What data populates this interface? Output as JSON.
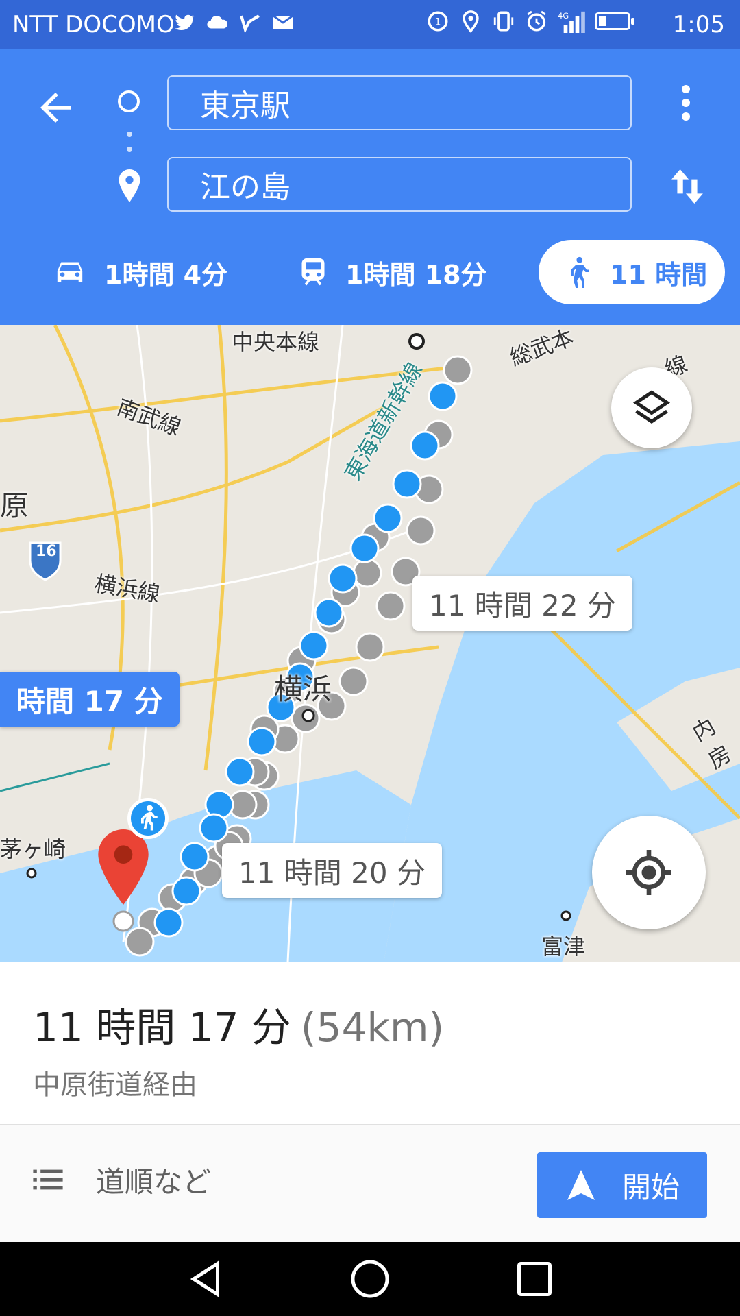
{
  "status_bar": {
    "carrier": "NTT DOCOMO",
    "time": "1:05",
    "network": "4G"
  },
  "header": {
    "origin": "東京駅",
    "destination": "江の島",
    "modes": [
      {
        "icon": "car-icon",
        "label": "1時間 4分"
      },
      {
        "icon": "train-icon",
        "label": "1時間 18分"
      },
      {
        "icon": "walk-icon",
        "label": "11 時間",
        "selected": true
      }
    ]
  },
  "map": {
    "labels": [
      "中央本線",
      "総武本",
      "線",
      "南武線",
      "東海道新幹線",
      "原",
      "横浜線",
      "横浜",
      "茅ヶ崎",
      "内房",
      "富津"
    ],
    "route_badge": "16",
    "bubbles": {
      "selected": "時間 17 分",
      "alt1": "11 時間 22 分",
      "alt2": "11 時間 20 分"
    },
    "route_color": "#2196f3",
    "alt_route_color": "#9e9e9e"
  },
  "summary": {
    "duration": "11 時間 17 分",
    "distance": "(54km)",
    "via": "中原街道経由"
  },
  "actions": {
    "steps_label": "道順など",
    "start_label": "開始"
  },
  "colors": {
    "primary": "#4285f4",
    "status_bar": "#3367d6",
    "water": "#aadaff"
  }
}
